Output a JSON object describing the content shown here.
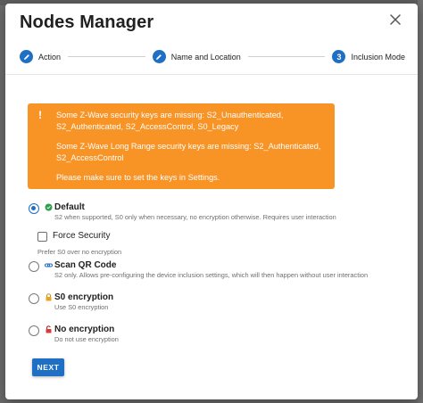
{
  "dialog": {
    "title": "Nodes Manager"
  },
  "stepper": {
    "steps": [
      {
        "label": "Action",
        "state": "complete"
      },
      {
        "label": "Name and Location",
        "state": "complete"
      },
      {
        "label": "Inclusion Mode",
        "number": "3",
        "state": "active"
      }
    ]
  },
  "alert": {
    "icon": "!",
    "line1": "Some Z-Wave security keys are missing: S2_Unauthenticated, S2_Authenticated, S2_AccessControl, S0_Legacy",
    "line2": "Some Z-Wave Long Range security keys are missing: S2_Authenticated, S2_AccessControl",
    "line3": "Please make sure to set the keys in Settings."
  },
  "options": [
    {
      "title": "Default",
      "icon": "shield-check-icon",
      "desc": "S2 when supported, S0 only when necessary, no encryption otherwise. Requires user interaction",
      "selected": true
    },
    {
      "title": "Scan QR Code",
      "icon": "link-icon",
      "desc": "S2 only. Allows pre-configuring the device inclusion settings, which will then happen without user interaction",
      "selected": false
    },
    {
      "title": "S0 encryption",
      "icon": "lock-icon",
      "desc": "Use S0 encryption",
      "selected": false
    },
    {
      "title": "No encryption",
      "icon": "unlock-icon",
      "desc": "Do not use encryption",
      "selected": false
    }
  ],
  "force_security": {
    "label": "Force Security",
    "desc": "Prefer S0 over no encryption",
    "checked": false
  },
  "buttons": {
    "next": "NEXT"
  },
  "colors": {
    "primary": "#1f6fc4",
    "warning": "#f89326",
    "secure_green": "#2e9d4a",
    "lock_orange": "#f0a020",
    "unlock_red": "#d83a3a"
  }
}
